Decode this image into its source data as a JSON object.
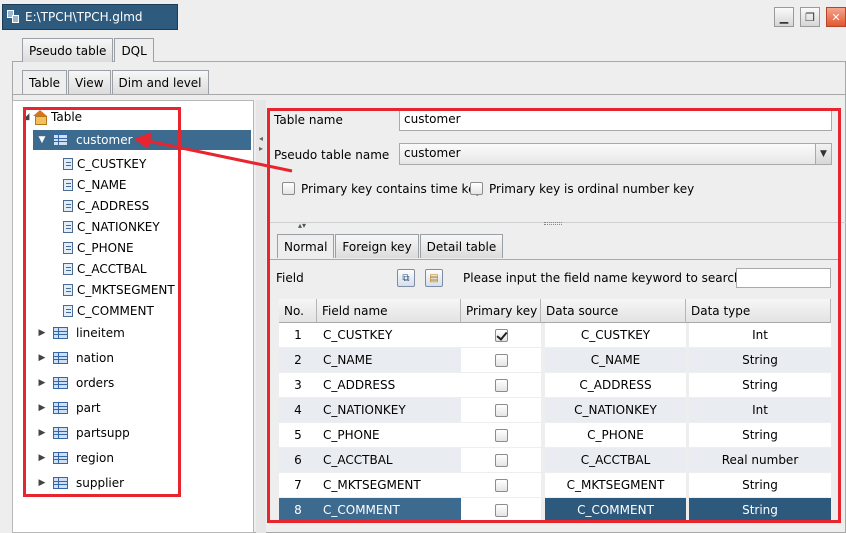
{
  "window": {
    "title": "E:\\TPCH\\TPCH.glmd",
    "buttons": [
      "minimize-icon",
      "restore-icon",
      "close-icon"
    ]
  },
  "top_tabs": [
    {
      "label": "Pseudo table",
      "active": false
    },
    {
      "label": "DQL",
      "active": true
    }
  ],
  "sub_tabs": [
    {
      "label": "Table",
      "active": true
    },
    {
      "label": "View",
      "active": false
    },
    {
      "label": "Dim and level",
      "active": false
    }
  ],
  "tree": {
    "root": "Table",
    "selected": "customer",
    "expanded_table": "customer",
    "fields": [
      "C_CUSTKEY",
      "C_NAME",
      "C_ADDRESS",
      "C_NATIONKEY",
      "C_PHONE",
      "C_ACCTBAL",
      "C_MKTSEGMENT",
      "C_COMMENT"
    ],
    "other_tables": [
      "lineitem",
      "nation",
      "orders",
      "part",
      "partsupp",
      "region",
      "supplier"
    ]
  },
  "form": {
    "table_name_label": "Table name",
    "table_name_value": "customer",
    "pseudo_table_label": "Pseudo table name",
    "pseudo_table_value": "customer",
    "pk_time_label": "Primary key contains time key",
    "pk_ordinal_label": "Primary key is ordinal number key"
  },
  "detail_tabs": [
    {
      "label": "Normal",
      "active": true
    },
    {
      "label": "Foreign key",
      "active": false
    },
    {
      "label": "Detail table",
      "active": false
    }
  ],
  "field_section": {
    "label": "Field",
    "search_prompt": "Please input the field name keyword to search:",
    "search_value": ""
  },
  "grid": {
    "columns": [
      "No.",
      "Field name",
      "Primary key",
      "Data source",
      "Data type"
    ],
    "rows": [
      {
        "no": "1",
        "field": "C_CUSTKEY",
        "pk": true,
        "source": "C_CUSTKEY",
        "type": "Int"
      },
      {
        "no": "2",
        "field": "C_NAME",
        "pk": false,
        "source": "C_NAME",
        "type": "String"
      },
      {
        "no": "3",
        "field": "C_ADDRESS",
        "pk": false,
        "source": "C_ADDRESS",
        "type": "String"
      },
      {
        "no": "4",
        "field": "C_NATIONKEY",
        "pk": false,
        "source": "C_NATIONKEY",
        "type": "Int"
      },
      {
        "no": "5",
        "field": "C_PHONE",
        "pk": false,
        "source": "C_PHONE",
        "type": "String"
      },
      {
        "no": "6",
        "field": "C_ACCTBAL",
        "pk": false,
        "source": "C_ACCTBAL",
        "type": "Real number"
      },
      {
        "no": "7",
        "field": "C_MKTSEGMENT",
        "pk": false,
        "source": "C_MKTSEGMENT",
        "type": "String"
      },
      {
        "no": "8",
        "field": "C_COMMENT",
        "pk": false,
        "source": "C_COMMENT",
        "type": "String"
      }
    ],
    "selected_row": 8
  },
  "colors": {
    "selection": "#3d6a8f",
    "title_bg": "#2e5a7e",
    "annotation": "#e8242e"
  }
}
